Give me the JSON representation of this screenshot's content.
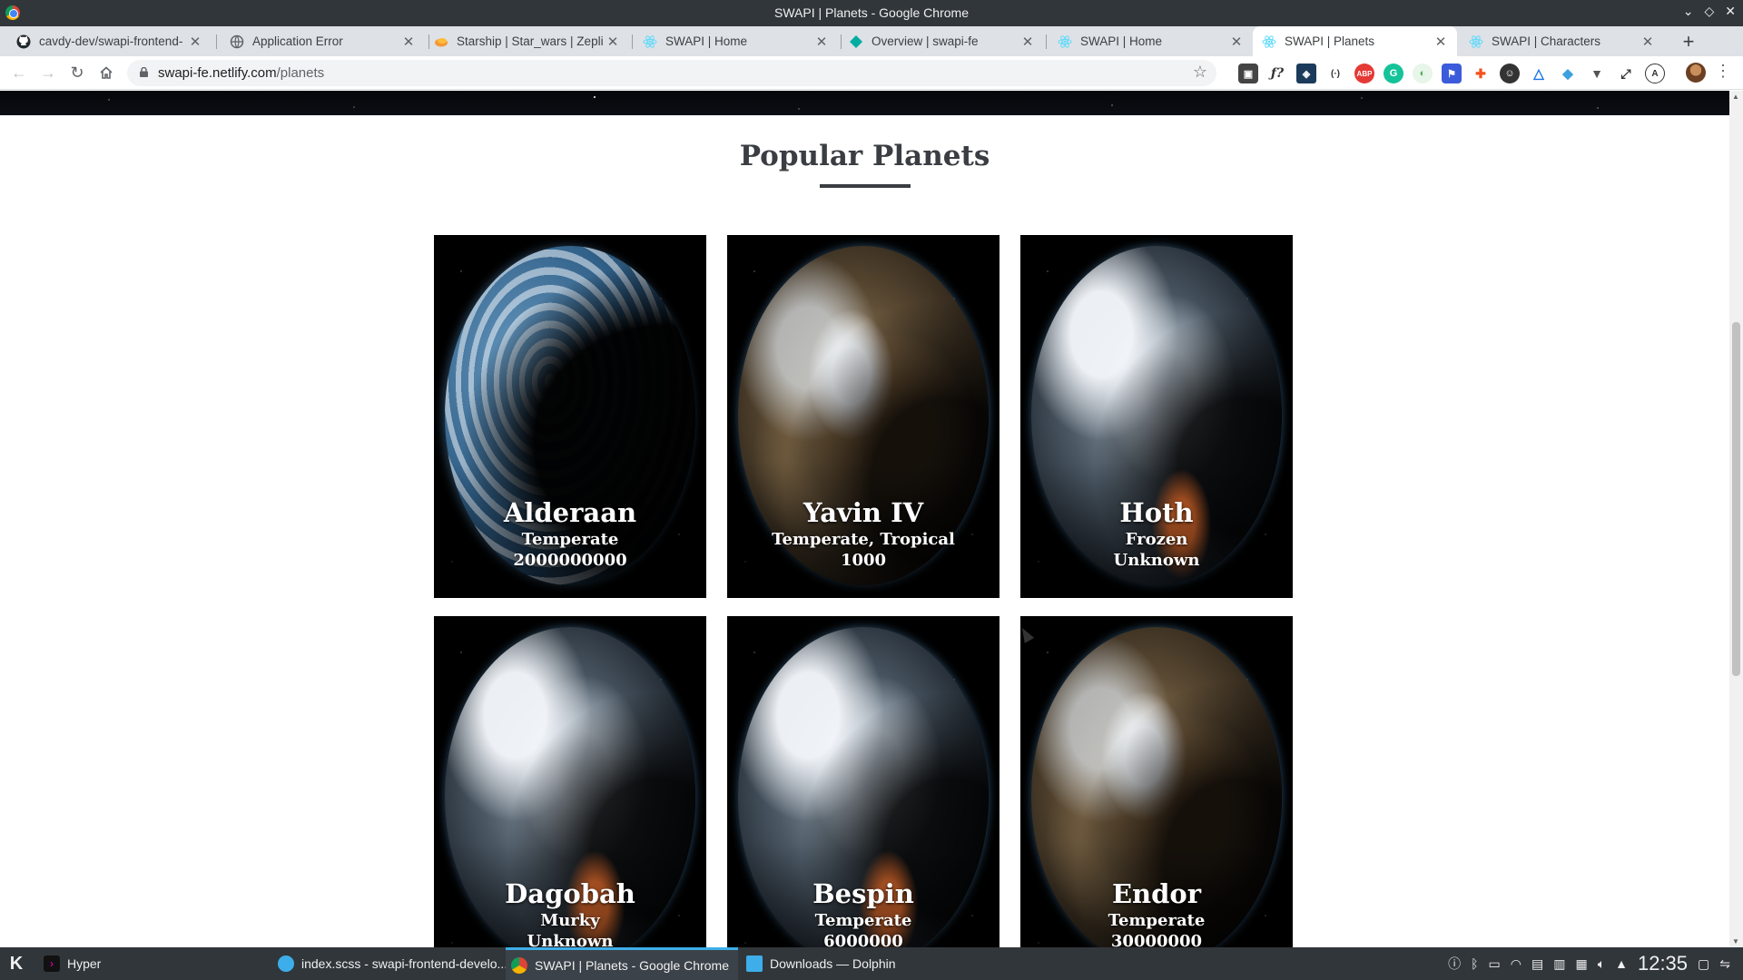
{
  "window": {
    "title": "SWAPI | Planets - Google Chrome"
  },
  "tabs": [
    {
      "label": "cavdy-dev/swapi-frontend-",
      "icon": "github-icon",
      "color": "#24292e"
    },
    {
      "label": "Application Error",
      "icon": "globe-icon",
      "color": "#5f6368"
    },
    {
      "label": "Starship | Star_wars | Zepli",
      "icon": "zeplin-icon",
      "color": "#f69833"
    },
    {
      "label": "SWAPI | Home",
      "icon": "react-icon",
      "color": "#61dafb"
    },
    {
      "label": "Overview | swapi-fe",
      "icon": "netlify-icon",
      "color": "#00ad9f"
    },
    {
      "label": "SWAPI | Home",
      "icon": "react-icon",
      "color": "#61dafb"
    },
    {
      "label": "SWAPI | Planets",
      "icon": "react-icon",
      "color": "#61dafb",
      "active": true
    },
    {
      "label": "SWAPI | Characters",
      "icon": "react-icon",
      "color": "#61dafb"
    }
  ],
  "omnibox": {
    "host": "swapi-fe.netlify.com",
    "path": "/planets"
  },
  "page": {
    "section_title": "Popular Planets",
    "planets": [
      {
        "name": "Alderaan",
        "climate": "Temperate",
        "population": "2000000000"
      },
      {
        "name": "Yavin IV",
        "climate": "Temperate, Tropical",
        "population": "1000"
      },
      {
        "name": "Hoth",
        "climate": "Frozen",
        "population": "Unknown"
      },
      {
        "name": "Dagobah",
        "climate": "Murky",
        "population": "Unknown"
      },
      {
        "name": "Bespin",
        "climate": "Temperate",
        "population": "6000000"
      },
      {
        "name": "Endor",
        "climate": "Temperate",
        "population": "30000000"
      }
    ]
  },
  "taskbar": {
    "tasks": [
      {
        "label": "Hyper",
        "icon": "terminal-icon"
      },
      {
        "label": "index.scss - swapi-frontend-develo...",
        "icon": "vscode-icon"
      },
      {
        "label": "SWAPI | Planets - Google Chrome",
        "icon": "chrome-icon",
        "active": true
      },
      {
        "label": "Downloads — Dolphin",
        "icon": "folder-icon"
      }
    ],
    "clock": "12:35"
  }
}
